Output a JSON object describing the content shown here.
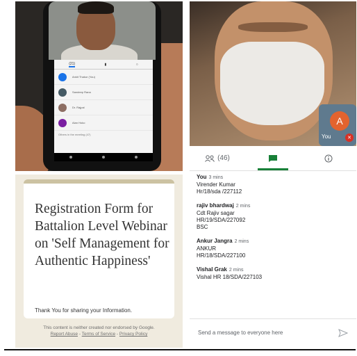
{
  "phone_panel": {
    "tabs": [
      "(21)",
      "",
      ""
    ],
    "participants": [
      {
        "label": "Ankit Thakur (You)",
        "avatar_letter": "A",
        "color": "#1a73e8"
      },
      {
        "label": "Sandeep Rana",
        "avatar_letter": "",
        "color": "#455a64"
      },
      {
        "label": "Dr. Rajpal",
        "avatar_letter": "",
        "color": "#8d6e63"
      },
      {
        "label": "Alan Hoko",
        "avatar_letter": "A",
        "color": "#7b1fa2"
      }
    ],
    "others_text": "Others in the meeting (47)"
  },
  "video_tile": {
    "self_avatar_letter": "A",
    "self_label": "You",
    "avatar_color": "#e3632e",
    "mic_muted_color": "#d93025"
  },
  "chat": {
    "tabs": {
      "people_label": "(46)",
      "chat_label": "",
      "info_label": ""
    },
    "accent": "#188038",
    "messages": [
      {
        "sender": "You",
        "time": "3 mins",
        "lines": [
          "Virender Kumar",
          "Hr/18/sda /227112"
        ]
      },
      {
        "sender": "rajiv bhardwaj",
        "time": "2 mins",
        "lines": [
          "Cdt Rajiv sagar",
          "HR/19/SDA/227092",
          "BSC"
        ]
      },
      {
        "sender": "Ankur Jangra",
        "time": "2 mins",
        "lines": [
          "ANKUR",
          "HR/18/SDA/227100"
        ]
      },
      {
        "sender": "Vishal Grak",
        "time": "2 mins",
        "lines": [
          "Vishal HR 18/SDA/227103"
        ]
      }
    ],
    "compose_placeholder": "Send a message to everyone here"
  },
  "form": {
    "title": "Registration Form for Battalion Level Webinar on 'Self Management for Authentic Happiness'",
    "thank_you": "Thank You for sharing your Information.",
    "footer_text": "This content is neither created nor endorsed by Google.",
    "report_abuse": "Report Abuse",
    "terms": "Terms of Service",
    "privacy": "Privacy Policy",
    "separator": "-"
  }
}
